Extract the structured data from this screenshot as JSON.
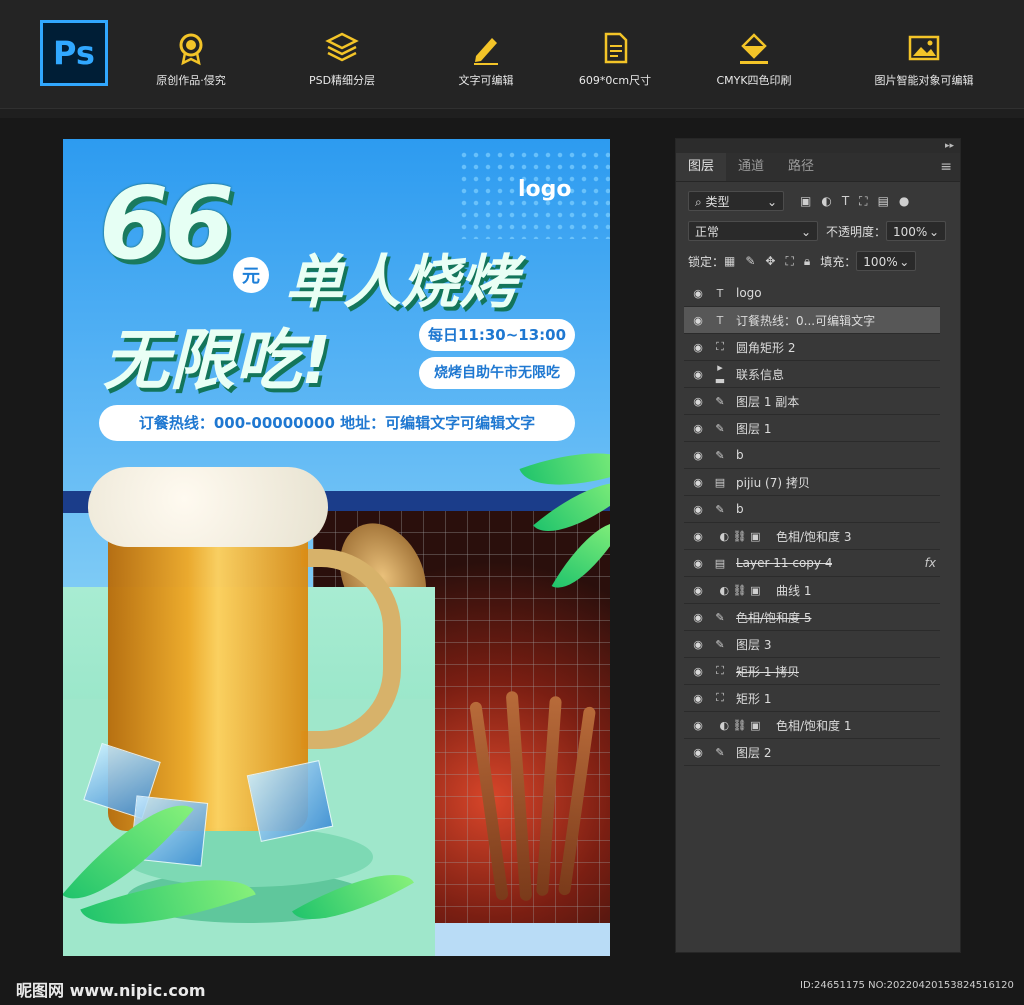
{
  "app": {
    "logo_text": "Ps"
  },
  "features": [
    {
      "label": "原创作品·侵究",
      "icon": "award-medal-icon"
    },
    {
      "label": "PSD精细分层",
      "icon": "layers-stack-icon"
    },
    {
      "label": "文字可编辑",
      "icon": "pencil-edit-icon"
    },
    {
      "label": "609*0cm尺寸",
      "icon": "document-size-icon"
    },
    {
      "label": "CMYK四色印刷",
      "icon": "paint-bucket-icon"
    },
    {
      "label": "图片智能对象可编辑",
      "icon": "image-frame-icon"
    }
  ],
  "poster": {
    "logo": "logo",
    "big_number": "66",
    "yuan": "元",
    "title_line1": "单人烧烤",
    "title_line2": "无限吃!",
    "time_pill": "每日11:30~13:00",
    "buffet_pill": "烧烤自助午市无限吃",
    "hotline": "订餐热线：000-00000000   地址：可编辑文字可编辑文字"
  },
  "panel": {
    "tabs": [
      "图层",
      "通道",
      "路径"
    ],
    "active_tab": "图层",
    "filter_label": "类型",
    "blend_mode": "正常",
    "opacity_label": "不透明度：",
    "opacity_value": "100%",
    "lock_label": "锁定：",
    "fill_label": "填充：",
    "fill_value": "100%",
    "layers": [
      {
        "name": "logo",
        "icon": "T",
        "strike": false
      },
      {
        "name": "订餐热线：0...可编辑文字",
        "icon": "T",
        "strike": false,
        "selected": true
      },
      {
        "name": "圆角矩形 2",
        "icon": "rect",
        "strike": false
      },
      {
        "name": "联系信息",
        "icon": "folder",
        "strike": false
      },
      {
        "name": "图层 1 副本",
        "icon": "brush",
        "strike": false
      },
      {
        "name": "图层 1",
        "icon": "brush",
        "strike": false
      },
      {
        "name": "b",
        "icon": "brush",
        "strike": false
      },
      {
        "name": "pijiu (7) 拷贝",
        "icon": "smart",
        "strike": false
      },
      {
        "name": "b",
        "icon": "brush",
        "strike": false
      },
      {
        "name": "色相/饱和度 3",
        "icon": "adjust",
        "strike": false
      },
      {
        "name": "Layer 11 copy 4",
        "icon": "smart",
        "strike": true,
        "fx": "fx"
      },
      {
        "name": "曲线 1",
        "icon": "adjust",
        "strike": false
      },
      {
        "name": "色相/饱和度 5",
        "icon": "brush",
        "strike": true
      },
      {
        "name": "图层 3",
        "icon": "brush",
        "strike": false
      },
      {
        "name": "矩形 1 拷贝",
        "icon": "rect",
        "strike": true
      },
      {
        "name": "矩形 1",
        "icon": "rect",
        "strike": false
      },
      {
        "name": "色相/饱和度 1",
        "icon": "adjust",
        "strike": false
      },
      {
        "name": "图层 2",
        "icon": "brush",
        "strike": false
      }
    ]
  },
  "footer": {
    "site": "昵图网 www.nipic.com",
    "id_text": "ID:24651175 NO:20220420153824516120"
  }
}
